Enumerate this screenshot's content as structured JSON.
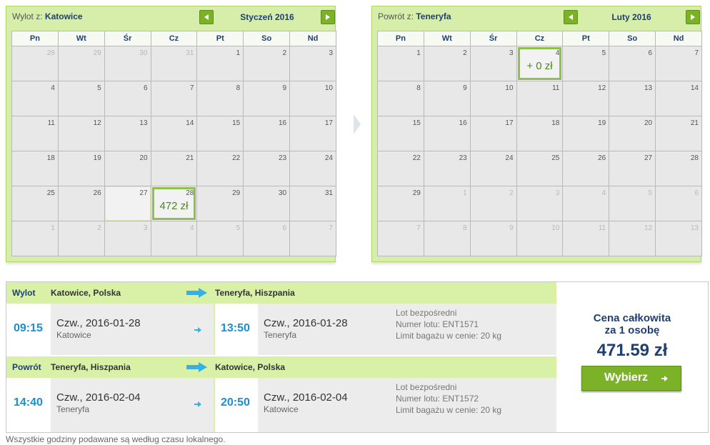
{
  "outbound_calendar": {
    "from_label": "Wylot z:",
    "from_city": "Katowice",
    "month": "Styczeń 2016",
    "weekdays": [
      "Pn",
      "Wt",
      "Śr",
      "Cz",
      "Pt",
      "So",
      "Nd"
    ],
    "weeks": [
      [
        "28",
        "29",
        "30",
        "31",
        "1",
        "2",
        "3"
      ],
      [
        "4",
        "5",
        "6",
        "7",
        "8",
        "9",
        "10"
      ],
      [
        "11",
        "12",
        "13",
        "14",
        "15",
        "16",
        "17"
      ],
      [
        "18",
        "19",
        "20",
        "21",
        "22",
        "23",
        "24"
      ],
      [
        "25",
        "26",
        "27",
        "28",
        "29",
        "30",
        "31"
      ],
      [
        "1",
        "2",
        "3",
        "4",
        "5",
        "6",
        "7"
      ]
    ],
    "selected_price": "472 zł"
  },
  "return_calendar": {
    "from_label": "Powrót z:",
    "from_city": "Teneryfa",
    "month": "Luty 2016",
    "weekdays": [
      "Pn",
      "Wt",
      "Śr",
      "Cz",
      "Pt",
      "So",
      "Nd"
    ],
    "weeks": [
      [
        "1",
        "2",
        "3",
        "4",
        "5",
        "6",
        "7"
      ],
      [
        "8",
        "9",
        "10",
        "11",
        "12",
        "13",
        "14"
      ],
      [
        "15",
        "16",
        "17",
        "18",
        "19",
        "20",
        "21"
      ],
      [
        "22",
        "23",
        "24",
        "25",
        "26",
        "27",
        "28"
      ],
      [
        "29",
        "1",
        "2",
        "3",
        "4",
        "5",
        "6"
      ],
      [
        "7",
        "8",
        "9",
        "10",
        "11",
        "12",
        "13"
      ]
    ],
    "selected_price": "+ 0 zł"
  },
  "outbound": {
    "label": "Wylot",
    "from": "Katowice, Polska",
    "to": "Teneryfa, Hiszpania",
    "dep_time": "09:15",
    "dep_date": "Czw., 2016-01-28",
    "dep_city": "Katowice",
    "arr_time": "13:50",
    "arr_date": "Czw., 2016-01-28",
    "arr_city": "Teneryfa",
    "info1": "Lot bezpośredni",
    "info2": "Numer lotu: ENT1571",
    "info3": "Limit bagażu w cenie: 20 kg"
  },
  "return": {
    "label": "Powrót",
    "from": "Teneryfa, Hiszpania",
    "to": "Katowice, Polska",
    "dep_time": "14:40",
    "dep_date": "Czw., 2016-02-04",
    "dep_city": "Teneryfa",
    "arr_time": "20:50",
    "arr_date": "Czw., 2016-02-04",
    "arr_city": "Katowice",
    "info1": "Lot bezpośredni",
    "info2": "Numer lotu: ENT1572",
    "info3": "Limit bagażu w cenie: 20 kg"
  },
  "price": {
    "line1": "Cena całkowita",
    "line2": "za 1 osobę",
    "amount": "471.59 zł",
    "button": "Wybierz"
  },
  "footer_note": "Wszystkie godziny podawane są według czasu lokalnego.",
  "colors": {
    "accent_green": "#7cb227",
    "light_green": "#d9f0a7",
    "navy": "#1f3f72",
    "time_blue": "#1a8fd2"
  }
}
